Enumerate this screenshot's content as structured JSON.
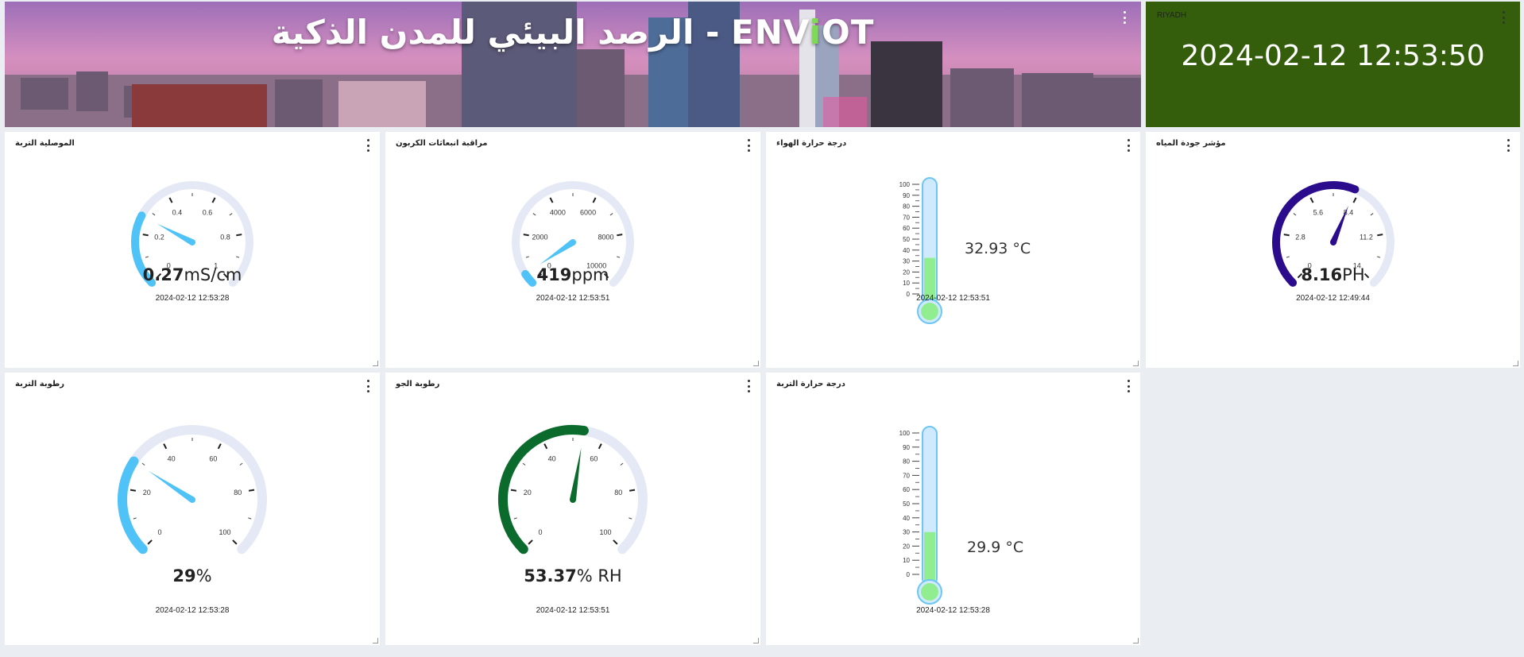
{
  "banner": {
    "title_ar": "الرصد البيئي للمدن الذكية - ",
    "title_en_1": "ENV",
    "title_en_accent": "i",
    "title_en_2": "OT"
  },
  "clock": {
    "label": "RIYADH",
    "time": "2024-02-12 12:53:50",
    "bg": "#345e0b"
  },
  "widgets": [
    {
      "title": "الموصلية التربة",
      "type": "gauge",
      "value": 0.27,
      "value_text": "0.27",
      "unit": "mS/cm",
      "min": 0,
      "max": 1,
      "ticks": [
        "0",
        "0.2",
        "0.4",
        "0.6",
        "0.8",
        "1"
      ],
      "color": "#4fc3f7",
      "timestamp": "2024-02-12 12:53:28"
    },
    {
      "title": "مراقبة انبعاثات الكربون",
      "type": "gauge",
      "value": 419,
      "value_text": "419",
      "unit": "ppm",
      "min": 0,
      "max": 10000,
      "ticks": [
        "0",
        "2000",
        "4000",
        "6000",
        "8000",
        "10000"
      ],
      "color": "#4fc3f7",
      "timestamp": "2024-02-12 12:53:51"
    },
    {
      "title": "درجة حرارة الهواء",
      "type": "thermometer",
      "value": 32.93,
      "value_text": "32.93 °C",
      "scale": [
        "100",
        "90",
        "80",
        "70",
        "60",
        "50",
        "40",
        "30",
        "20",
        "10",
        "0"
      ],
      "fill_color": "#90ee90",
      "timestamp": "2024-02-12 12:53:51"
    },
    {
      "title": "مؤشر جودة المياه",
      "type": "gauge",
      "value": 8.16,
      "value_text": "8.16",
      "unit": "PH",
      "min": 0,
      "max": 14,
      "ticks": [
        "0",
        "2.8",
        "5.6",
        "8.4",
        "11.2",
        "14"
      ],
      "color": "#2a0c8c",
      "timestamp": "2024-02-12 12:49:44"
    },
    {
      "title": "رطوبة التربة",
      "type": "gauge",
      "value": 29,
      "value_text": "29",
      "unit": "%",
      "min": 0,
      "max": 100,
      "ticks": [
        "0",
        "20",
        "40",
        "60",
        "80",
        "100"
      ],
      "color": "#4fc3f7",
      "timestamp": "2024-02-12 12:53:28"
    },
    {
      "title": "رطوبة الجو",
      "type": "gauge",
      "value": 53.37,
      "value_text": "53.37",
      "unit": "% RH",
      "min": 0,
      "max": 100,
      "ticks": [
        "0",
        "20",
        "40",
        "60",
        "80",
        "100"
      ],
      "color": "#0b6b2c",
      "timestamp": "2024-02-12 12:53:51"
    },
    {
      "title": "درجة حرارة التربة",
      "type": "thermometer",
      "value": 29.9,
      "value_text": "29.9 °C",
      "scale": [
        "100",
        "90",
        "80",
        "70",
        "60",
        "50",
        "40",
        "30",
        "20",
        "10",
        "0"
      ],
      "fill_color": "#90ee90",
      "timestamp": "2024-02-12 12:53:28"
    }
  ]
}
